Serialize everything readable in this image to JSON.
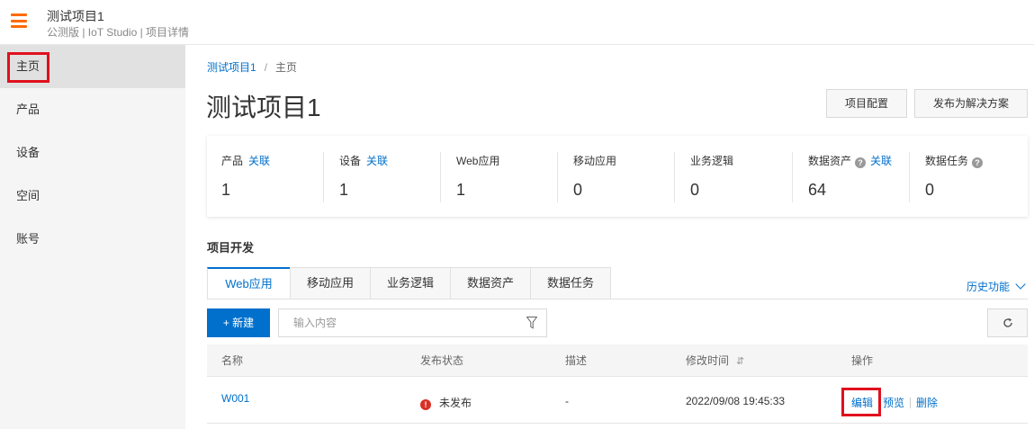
{
  "header": {
    "title": "测试项目1",
    "subtitle": "公测版 | IoT Studio | 项目详情"
  },
  "sidebar": {
    "items": [
      {
        "label": "主页",
        "active": true
      },
      {
        "label": "产品"
      },
      {
        "label": "设备"
      },
      {
        "label": "空间"
      },
      {
        "label": "账号"
      }
    ]
  },
  "breadcrumb": {
    "parent": "测试项目1",
    "separator": "/",
    "current": "主页"
  },
  "page": {
    "title": "测试项目1",
    "config_button": "项目配置",
    "publish_button": "发布为解决方案"
  },
  "stats": [
    {
      "label": "产品",
      "link": "关联",
      "value": "1"
    },
    {
      "label": "设备",
      "link": "关联",
      "value": "1"
    },
    {
      "label": "Web应用",
      "value": "1"
    },
    {
      "label": "移动应用",
      "value": "0"
    },
    {
      "label": "业务逻辑",
      "value": "0"
    },
    {
      "label": "数据资产",
      "help": true,
      "link": "关联",
      "value": "64"
    },
    {
      "label": "数据任务",
      "help": true,
      "value": "0"
    }
  ],
  "section": {
    "title": "项目开发"
  },
  "tabs": [
    {
      "label": "Web应用",
      "active": true
    },
    {
      "label": "移动应用"
    },
    {
      "label": "业务逻辑"
    },
    {
      "label": "数据资产"
    },
    {
      "label": "数据任务"
    }
  ],
  "history_link": "历史功能",
  "toolbar": {
    "new_button": "+ 新建",
    "search_placeholder": "输入内容"
  },
  "table": {
    "columns": [
      "名称",
      "发布状态",
      "描述",
      "修改时间",
      "操作"
    ],
    "rows": [
      {
        "name": "W001",
        "status": "未发布",
        "description": "-",
        "modified": "2022/09/08 19:45:33",
        "actions": [
          "编辑",
          "预览",
          "删除"
        ]
      }
    ]
  },
  "colors": {
    "brand_orange": "#ff6a00",
    "link_blue": "#0070cc",
    "highlight_red": "#e0101e",
    "error_red": "#d93026"
  }
}
